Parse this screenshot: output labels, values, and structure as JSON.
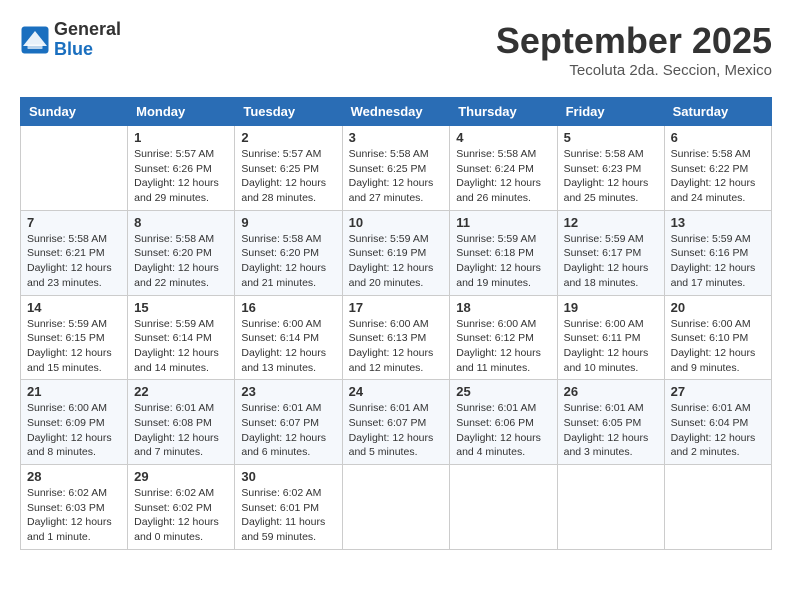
{
  "logo": {
    "line1": "General",
    "line2": "Blue"
  },
  "title": "September 2025",
  "location": "Tecoluta 2da. Seccion, Mexico",
  "weekdays": [
    "Sunday",
    "Monday",
    "Tuesday",
    "Wednesday",
    "Thursday",
    "Friday",
    "Saturday"
  ],
  "weeks": [
    [
      {
        "day": "",
        "info": ""
      },
      {
        "day": "1",
        "info": "Sunrise: 5:57 AM\nSunset: 6:26 PM\nDaylight: 12 hours\nand 29 minutes."
      },
      {
        "day": "2",
        "info": "Sunrise: 5:57 AM\nSunset: 6:25 PM\nDaylight: 12 hours\nand 28 minutes."
      },
      {
        "day": "3",
        "info": "Sunrise: 5:58 AM\nSunset: 6:25 PM\nDaylight: 12 hours\nand 27 minutes."
      },
      {
        "day": "4",
        "info": "Sunrise: 5:58 AM\nSunset: 6:24 PM\nDaylight: 12 hours\nand 26 minutes."
      },
      {
        "day": "5",
        "info": "Sunrise: 5:58 AM\nSunset: 6:23 PM\nDaylight: 12 hours\nand 25 minutes."
      },
      {
        "day": "6",
        "info": "Sunrise: 5:58 AM\nSunset: 6:22 PM\nDaylight: 12 hours\nand 24 minutes."
      }
    ],
    [
      {
        "day": "7",
        "info": "Sunrise: 5:58 AM\nSunset: 6:21 PM\nDaylight: 12 hours\nand 23 minutes."
      },
      {
        "day": "8",
        "info": "Sunrise: 5:58 AM\nSunset: 6:20 PM\nDaylight: 12 hours\nand 22 minutes."
      },
      {
        "day": "9",
        "info": "Sunrise: 5:58 AM\nSunset: 6:20 PM\nDaylight: 12 hours\nand 21 minutes."
      },
      {
        "day": "10",
        "info": "Sunrise: 5:59 AM\nSunset: 6:19 PM\nDaylight: 12 hours\nand 20 minutes."
      },
      {
        "day": "11",
        "info": "Sunrise: 5:59 AM\nSunset: 6:18 PM\nDaylight: 12 hours\nand 19 minutes."
      },
      {
        "day": "12",
        "info": "Sunrise: 5:59 AM\nSunset: 6:17 PM\nDaylight: 12 hours\nand 18 minutes."
      },
      {
        "day": "13",
        "info": "Sunrise: 5:59 AM\nSunset: 6:16 PM\nDaylight: 12 hours\nand 17 minutes."
      }
    ],
    [
      {
        "day": "14",
        "info": "Sunrise: 5:59 AM\nSunset: 6:15 PM\nDaylight: 12 hours\nand 15 minutes."
      },
      {
        "day": "15",
        "info": "Sunrise: 5:59 AM\nSunset: 6:14 PM\nDaylight: 12 hours\nand 14 minutes."
      },
      {
        "day": "16",
        "info": "Sunrise: 6:00 AM\nSunset: 6:14 PM\nDaylight: 12 hours\nand 13 minutes."
      },
      {
        "day": "17",
        "info": "Sunrise: 6:00 AM\nSunset: 6:13 PM\nDaylight: 12 hours\nand 12 minutes."
      },
      {
        "day": "18",
        "info": "Sunrise: 6:00 AM\nSunset: 6:12 PM\nDaylight: 12 hours\nand 11 minutes."
      },
      {
        "day": "19",
        "info": "Sunrise: 6:00 AM\nSunset: 6:11 PM\nDaylight: 12 hours\nand 10 minutes."
      },
      {
        "day": "20",
        "info": "Sunrise: 6:00 AM\nSunset: 6:10 PM\nDaylight: 12 hours\nand 9 minutes."
      }
    ],
    [
      {
        "day": "21",
        "info": "Sunrise: 6:00 AM\nSunset: 6:09 PM\nDaylight: 12 hours\nand 8 minutes."
      },
      {
        "day": "22",
        "info": "Sunrise: 6:01 AM\nSunset: 6:08 PM\nDaylight: 12 hours\nand 7 minutes."
      },
      {
        "day": "23",
        "info": "Sunrise: 6:01 AM\nSunset: 6:07 PM\nDaylight: 12 hours\nand 6 minutes."
      },
      {
        "day": "24",
        "info": "Sunrise: 6:01 AM\nSunset: 6:07 PM\nDaylight: 12 hours\nand 5 minutes."
      },
      {
        "day": "25",
        "info": "Sunrise: 6:01 AM\nSunset: 6:06 PM\nDaylight: 12 hours\nand 4 minutes."
      },
      {
        "day": "26",
        "info": "Sunrise: 6:01 AM\nSunset: 6:05 PM\nDaylight: 12 hours\nand 3 minutes."
      },
      {
        "day": "27",
        "info": "Sunrise: 6:01 AM\nSunset: 6:04 PM\nDaylight: 12 hours\nand 2 minutes."
      }
    ],
    [
      {
        "day": "28",
        "info": "Sunrise: 6:02 AM\nSunset: 6:03 PM\nDaylight: 12 hours\nand 1 minute."
      },
      {
        "day": "29",
        "info": "Sunrise: 6:02 AM\nSunset: 6:02 PM\nDaylight: 12 hours\nand 0 minutes."
      },
      {
        "day": "30",
        "info": "Sunrise: 6:02 AM\nSunset: 6:01 PM\nDaylight: 11 hours\nand 59 minutes."
      },
      {
        "day": "",
        "info": ""
      },
      {
        "day": "",
        "info": ""
      },
      {
        "day": "",
        "info": ""
      },
      {
        "day": "",
        "info": ""
      }
    ]
  ]
}
